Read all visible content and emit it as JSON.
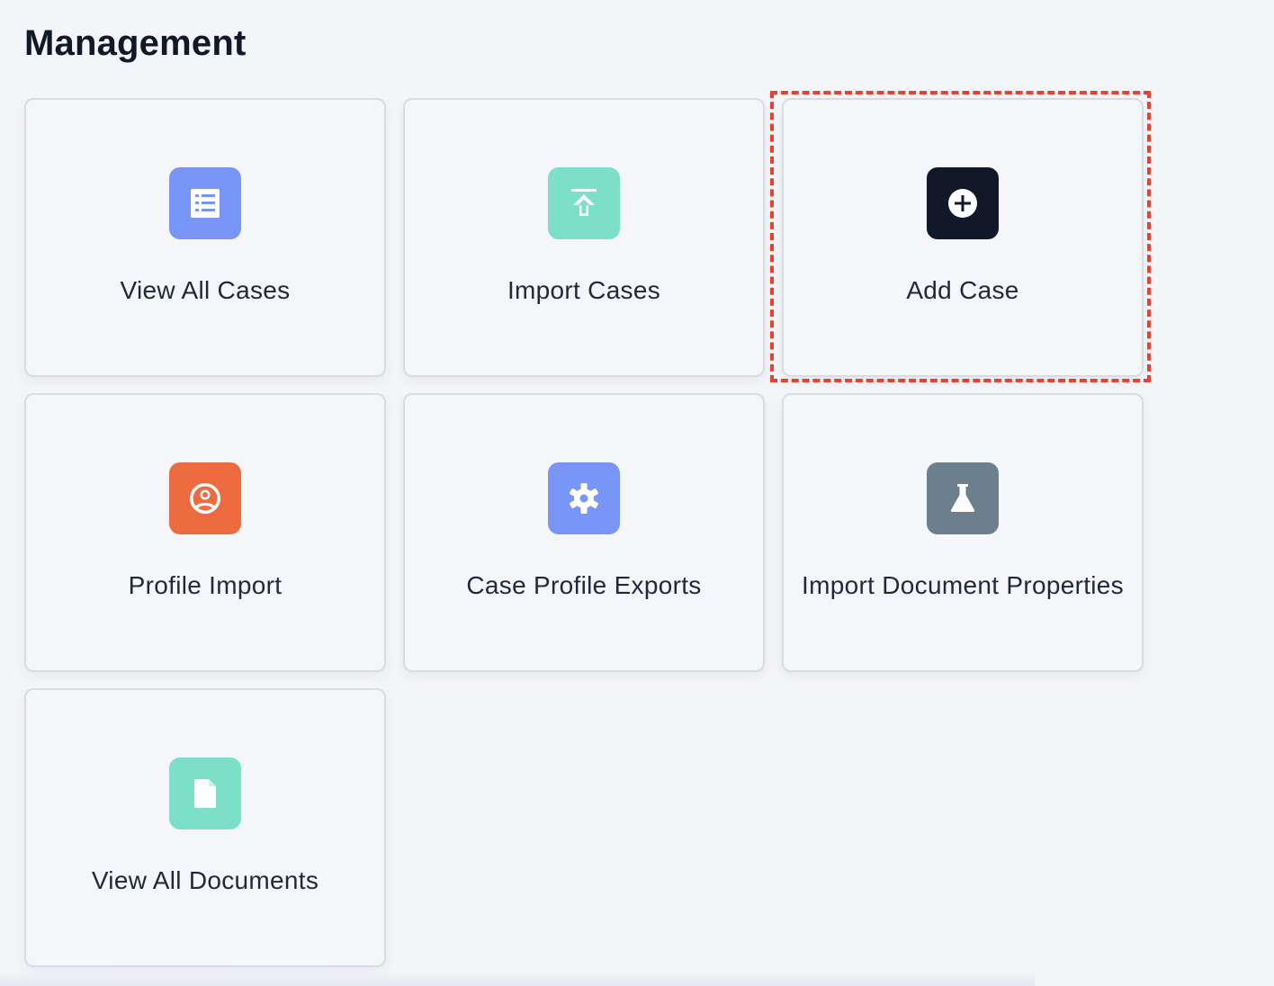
{
  "page": {
    "title": "Management"
  },
  "tiles": [
    {
      "label": "View All Cases",
      "icon": "list-icon",
      "color": "#7895f7"
    },
    {
      "label": "Import Cases",
      "icon": "upload-icon",
      "color": "#7ce0c8"
    },
    {
      "label": "Add Case",
      "icon": "plus-circle-icon",
      "color": "#111827"
    },
    {
      "label": "Profile Import",
      "icon": "user-circle-icon",
      "color": "#ee6a3f"
    },
    {
      "label": "Case Profile Exports",
      "icon": "gear-icon",
      "color": "#7895f7"
    },
    {
      "label": "Import Document Properties",
      "icon": "flask-icon",
      "color": "#6b7f8c"
    },
    {
      "label": "View All Documents",
      "icon": "document-icon",
      "color": "#7ce0c8"
    }
  ],
  "highlight": {
    "color": "#e8412f",
    "target": "Add Case"
  }
}
